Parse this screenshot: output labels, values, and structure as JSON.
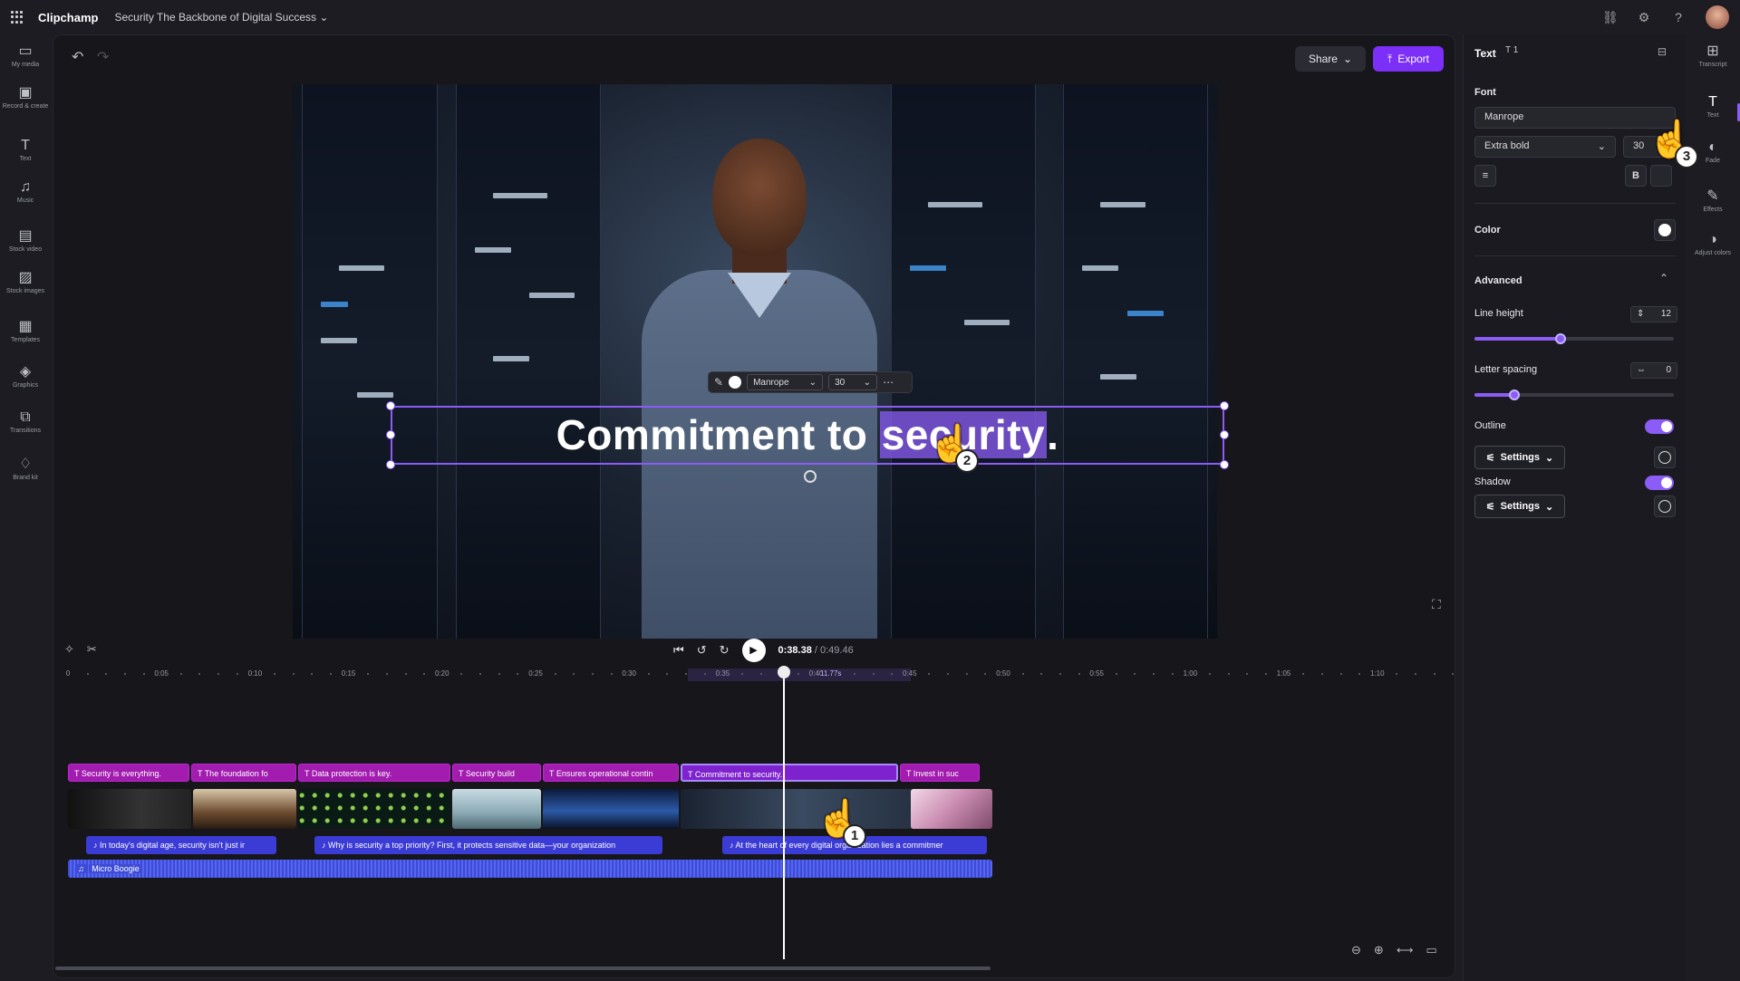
{
  "app": {
    "name": "Clipchamp",
    "project_title": "Security The Backbone of Digital Success"
  },
  "leftnav": [
    {
      "label": "My media",
      "icon": "folder-icon",
      "glyph": "▭"
    },
    {
      "label": "Record & create",
      "icon": "camera-icon",
      "glyph": "▣"
    },
    {
      "label": "Text",
      "icon": "text-icon",
      "glyph": "T"
    },
    {
      "label": "Music",
      "icon": "music-icon",
      "glyph": "♫"
    },
    {
      "label": "Stock video",
      "icon": "film-icon",
      "glyph": "▤"
    },
    {
      "label": "Stock images",
      "icon": "image-icon",
      "glyph": "▨"
    },
    {
      "label": "Templates",
      "icon": "templates-icon",
      "glyph": "▦"
    },
    {
      "label": "Graphics",
      "icon": "shapes-icon",
      "glyph": "◈"
    },
    {
      "label": "Transitions",
      "icon": "transitions-icon",
      "glyph": "⧉"
    },
    {
      "label": "Brand kit",
      "icon": "brand-icon",
      "glyph": "♢"
    }
  ],
  "toolbar": {
    "share_label": "Share",
    "export_label": "Export"
  },
  "preview": {
    "caption_plain": "Commitment to ",
    "caption_highlight": "security",
    "caption_end": ".",
    "toolbar_font": "Manrope",
    "toolbar_size": "30"
  },
  "playback": {
    "current": "0:38.38",
    "duration": "/ 0:49.46"
  },
  "ruler": {
    "ticks": [
      "0",
      "0:05",
      "0:10",
      "0:15",
      "0:20",
      "0:25",
      "0:30",
      "0:35",
      "0:40",
      "0:45",
      "0:50",
      "0:55",
      "1:00",
      "1:05",
      "1:10"
    ],
    "selection_label": "11.77s"
  },
  "text_clips": [
    "Security is everything.",
    "The foundation fo",
    "Data protection is key.",
    "Security build",
    "Ensures operational contin",
    "Commitment to security.",
    "Invest in suc"
  ],
  "caption_clips": [
    "In today's digital age, security isn't just ir",
    "Why is security a top priority? First, it protects sensitive data—your organization",
    "At the heart of every digital organization lies a commitmer"
  ],
  "audio_clip": "Micro Boogie",
  "panel": {
    "title": "Text",
    "badge": "T 1",
    "font_label": "Font",
    "font_value": "Manrope",
    "weight_value": "Extra bold",
    "size_value": "30",
    "bold_label": "B",
    "color_label": "Color",
    "advanced_label": "Advanced",
    "line_height_label": "Line height",
    "line_height_value": "12",
    "letter_spacing_label": "Letter spacing",
    "letter_spacing_value": "0",
    "outline_label": "Outline",
    "shadow_label": "Shadow",
    "settings_label": "Settings",
    "outline_on": true,
    "shadow_on": true
  },
  "rightrail": [
    {
      "label": "Transcript",
      "icon": "transcript-icon",
      "glyph": "⊞"
    },
    {
      "label": "Text",
      "icon": "text-icon",
      "glyph": "T"
    },
    {
      "label": "Fade",
      "icon": "fade-icon",
      "glyph": "◐"
    },
    {
      "label": "Effects",
      "icon": "effects-icon",
      "glyph": "✎"
    },
    {
      "label": "Adjust colors",
      "icon": "adjust-colors-icon",
      "glyph": "◑"
    }
  ],
  "annotations": [
    "1",
    "2",
    "3"
  ],
  "colors": {
    "accent": "#7b2ff7",
    "text_clip": "#a21caf",
    "caption_clip": "#3b3bd6",
    "audio_clip": "#3d4bd6"
  }
}
